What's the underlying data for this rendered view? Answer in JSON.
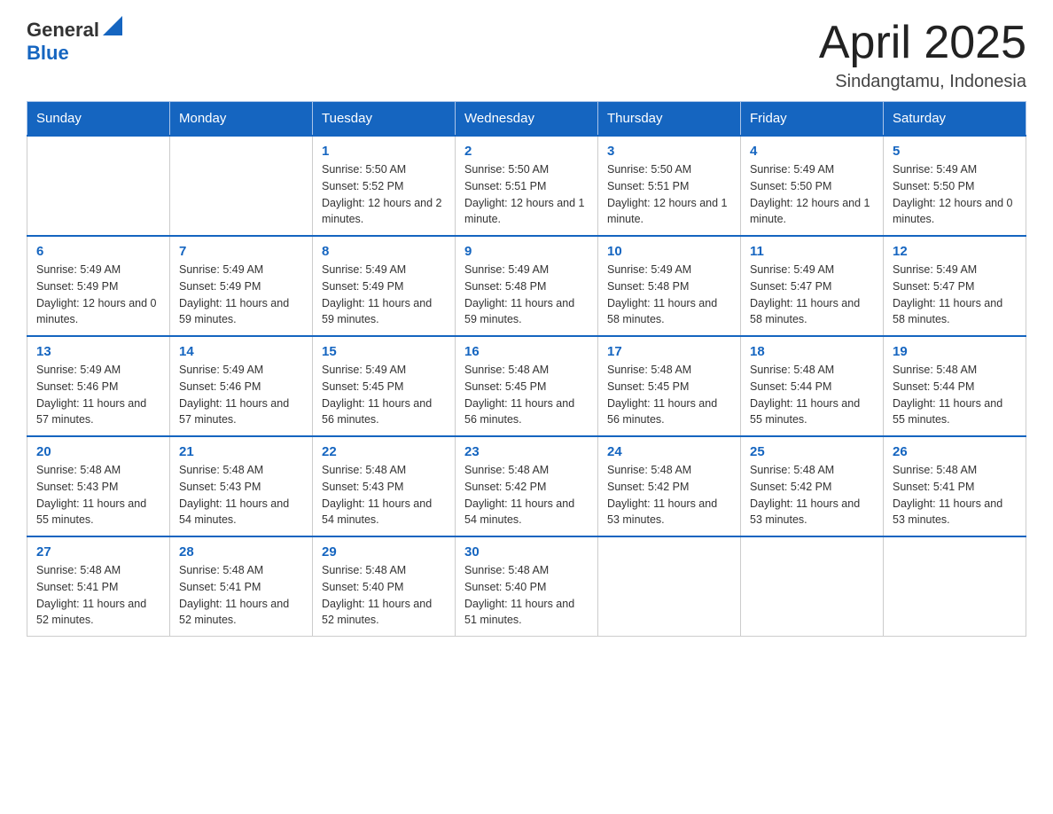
{
  "header": {
    "logo_general": "General",
    "logo_blue": "Blue",
    "title": "April 2025",
    "subtitle": "Sindangtamu, Indonesia"
  },
  "weekdays": [
    "Sunday",
    "Monday",
    "Tuesday",
    "Wednesday",
    "Thursday",
    "Friday",
    "Saturday"
  ],
  "weeks": [
    [
      {
        "day": "",
        "sunrise": "",
        "sunset": "",
        "daylight": ""
      },
      {
        "day": "",
        "sunrise": "",
        "sunset": "",
        "daylight": ""
      },
      {
        "day": "1",
        "sunrise": "Sunrise: 5:50 AM",
        "sunset": "Sunset: 5:52 PM",
        "daylight": "Daylight: 12 hours and 2 minutes."
      },
      {
        "day": "2",
        "sunrise": "Sunrise: 5:50 AM",
        "sunset": "Sunset: 5:51 PM",
        "daylight": "Daylight: 12 hours and 1 minute."
      },
      {
        "day": "3",
        "sunrise": "Sunrise: 5:50 AM",
        "sunset": "Sunset: 5:51 PM",
        "daylight": "Daylight: 12 hours and 1 minute."
      },
      {
        "day": "4",
        "sunrise": "Sunrise: 5:49 AM",
        "sunset": "Sunset: 5:50 PM",
        "daylight": "Daylight: 12 hours and 1 minute."
      },
      {
        "day": "5",
        "sunrise": "Sunrise: 5:49 AM",
        "sunset": "Sunset: 5:50 PM",
        "daylight": "Daylight: 12 hours and 0 minutes."
      }
    ],
    [
      {
        "day": "6",
        "sunrise": "Sunrise: 5:49 AM",
        "sunset": "Sunset: 5:49 PM",
        "daylight": "Daylight: 12 hours and 0 minutes."
      },
      {
        "day": "7",
        "sunrise": "Sunrise: 5:49 AM",
        "sunset": "Sunset: 5:49 PM",
        "daylight": "Daylight: 11 hours and 59 minutes."
      },
      {
        "day": "8",
        "sunrise": "Sunrise: 5:49 AM",
        "sunset": "Sunset: 5:49 PM",
        "daylight": "Daylight: 11 hours and 59 minutes."
      },
      {
        "day": "9",
        "sunrise": "Sunrise: 5:49 AM",
        "sunset": "Sunset: 5:48 PM",
        "daylight": "Daylight: 11 hours and 59 minutes."
      },
      {
        "day": "10",
        "sunrise": "Sunrise: 5:49 AM",
        "sunset": "Sunset: 5:48 PM",
        "daylight": "Daylight: 11 hours and 58 minutes."
      },
      {
        "day": "11",
        "sunrise": "Sunrise: 5:49 AM",
        "sunset": "Sunset: 5:47 PM",
        "daylight": "Daylight: 11 hours and 58 minutes."
      },
      {
        "day": "12",
        "sunrise": "Sunrise: 5:49 AM",
        "sunset": "Sunset: 5:47 PM",
        "daylight": "Daylight: 11 hours and 58 minutes."
      }
    ],
    [
      {
        "day": "13",
        "sunrise": "Sunrise: 5:49 AM",
        "sunset": "Sunset: 5:46 PM",
        "daylight": "Daylight: 11 hours and 57 minutes."
      },
      {
        "day": "14",
        "sunrise": "Sunrise: 5:49 AM",
        "sunset": "Sunset: 5:46 PM",
        "daylight": "Daylight: 11 hours and 57 minutes."
      },
      {
        "day": "15",
        "sunrise": "Sunrise: 5:49 AM",
        "sunset": "Sunset: 5:45 PM",
        "daylight": "Daylight: 11 hours and 56 minutes."
      },
      {
        "day": "16",
        "sunrise": "Sunrise: 5:48 AM",
        "sunset": "Sunset: 5:45 PM",
        "daylight": "Daylight: 11 hours and 56 minutes."
      },
      {
        "day": "17",
        "sunrise": "Sunrise: 5:48 AM",
        "sunset": "Sunset: 5:45 PM",
        "daylight": "Daylight: 11 hours and 56 minutes."
      },
      {
        "day": "18",
        "sunrise": "Sunrise: 5:48 AM",
        "sunset": "Sunset: 5:44 PM",
        "daylight": "Daylight: 11 hours and 55 minutes."
      },
      {
        "day": "19",
        "sunrise": "Sunrise: 5:48 AM",
        "sunset": "Sunset: 5:44 PM",
        "daylight": "Daylight: 11 hours and 55 minutes."
      }
    ],
    [
      {
        "day": "20",
        "sunrise": "Sunrise: 5:48 AM",
        "sunset": "Sunset: 5:43 PM",
        "daylight": "Daylight: 11 hours and 55 minutes."
      },
      {
        "day": "21",
        "sunrise": "Sunrise: 5:48 AM",
        "sunset": "Sunset: 5:43 PM",
        "daylight": "Daylight: 11 hours and 54 minutes."
      },
      {
        "day": "22",
        "sunrise": "Sunrise: 5:48 AM",
        "sunset": "Sunset: 5:43 PM",
        "daylight": "Daylight: 11 hours and 54 minutes."
      },
      {
        "day": "23",
        "sunrise": "Sunrise: 5:48 AM",
        "sunset": "Sunset: 5:42 PM",
        "daylight": "Daylight: 11 hours and 54 minutes."
      },
      {
        "day": "24",
        "sunrise": "Sunrise: 5:48 AM",
        "sunset": "Sunset: 5:42 PM",
        "daylight": "Daylight: 11 hours and 53 minutes."
      },
      {
        "day": "25",
        "sunrise": "Sunrise: 5:48 AM",
        "sunset": "Sunset: 5:42 PM",
        "daylight": "Daylight: 11 hours and 53 minutes."
      },
      {
        "day": "26",
        "sunrise": "Sunrise: 5:48 AM",
        "sunset": "Sunset: 5:41 PM",
        "daylight": "Daylight: 11 hours and 53 minutes."
      }
    ],
    [
      {
        "day": "27",
        "sunrise": "Sunrise: 5:48 AM",
        "sunset": "Sunset: 5:41 PM",
        "daylight": "Daylight: 11 hours and 52 minutes."
      },
      {
        "day": "28",
        "sunrise": "Sunrise: 5:48 AM",
        "sunset": "Sunset: 5:41 PM",
        "daylight": "Daylight: 11 hours and 52 minutes."
      },
      {
        "day": "29",
        "sunrise": "Sunrise: 5:48 AM",
        "sunset": "Sunset: 5:40 PM",
        "daylight": "Daylight: 11 hours and 52 minutes."
      },
      {
        "day": "30",
        "sunrise": "Sunrise: 5:48 AM",
        "sunset": "Sunset: 5:40 PM",
        "daylight": "Daylight: 11 hours and 51 minutes."
      },
      {
        "day": "",
        "sunrise": "",
        "sunset": "",
        "daylight": ""
      },
      {
        "day": "",
        "sunrise": "",
        "sunset": "",
        "daylight": ""
      },
      {
        "day": "",
        "sunrise": "",
        "sunset": "",
        "daylight": ""
      }
    ]
  ]
}
